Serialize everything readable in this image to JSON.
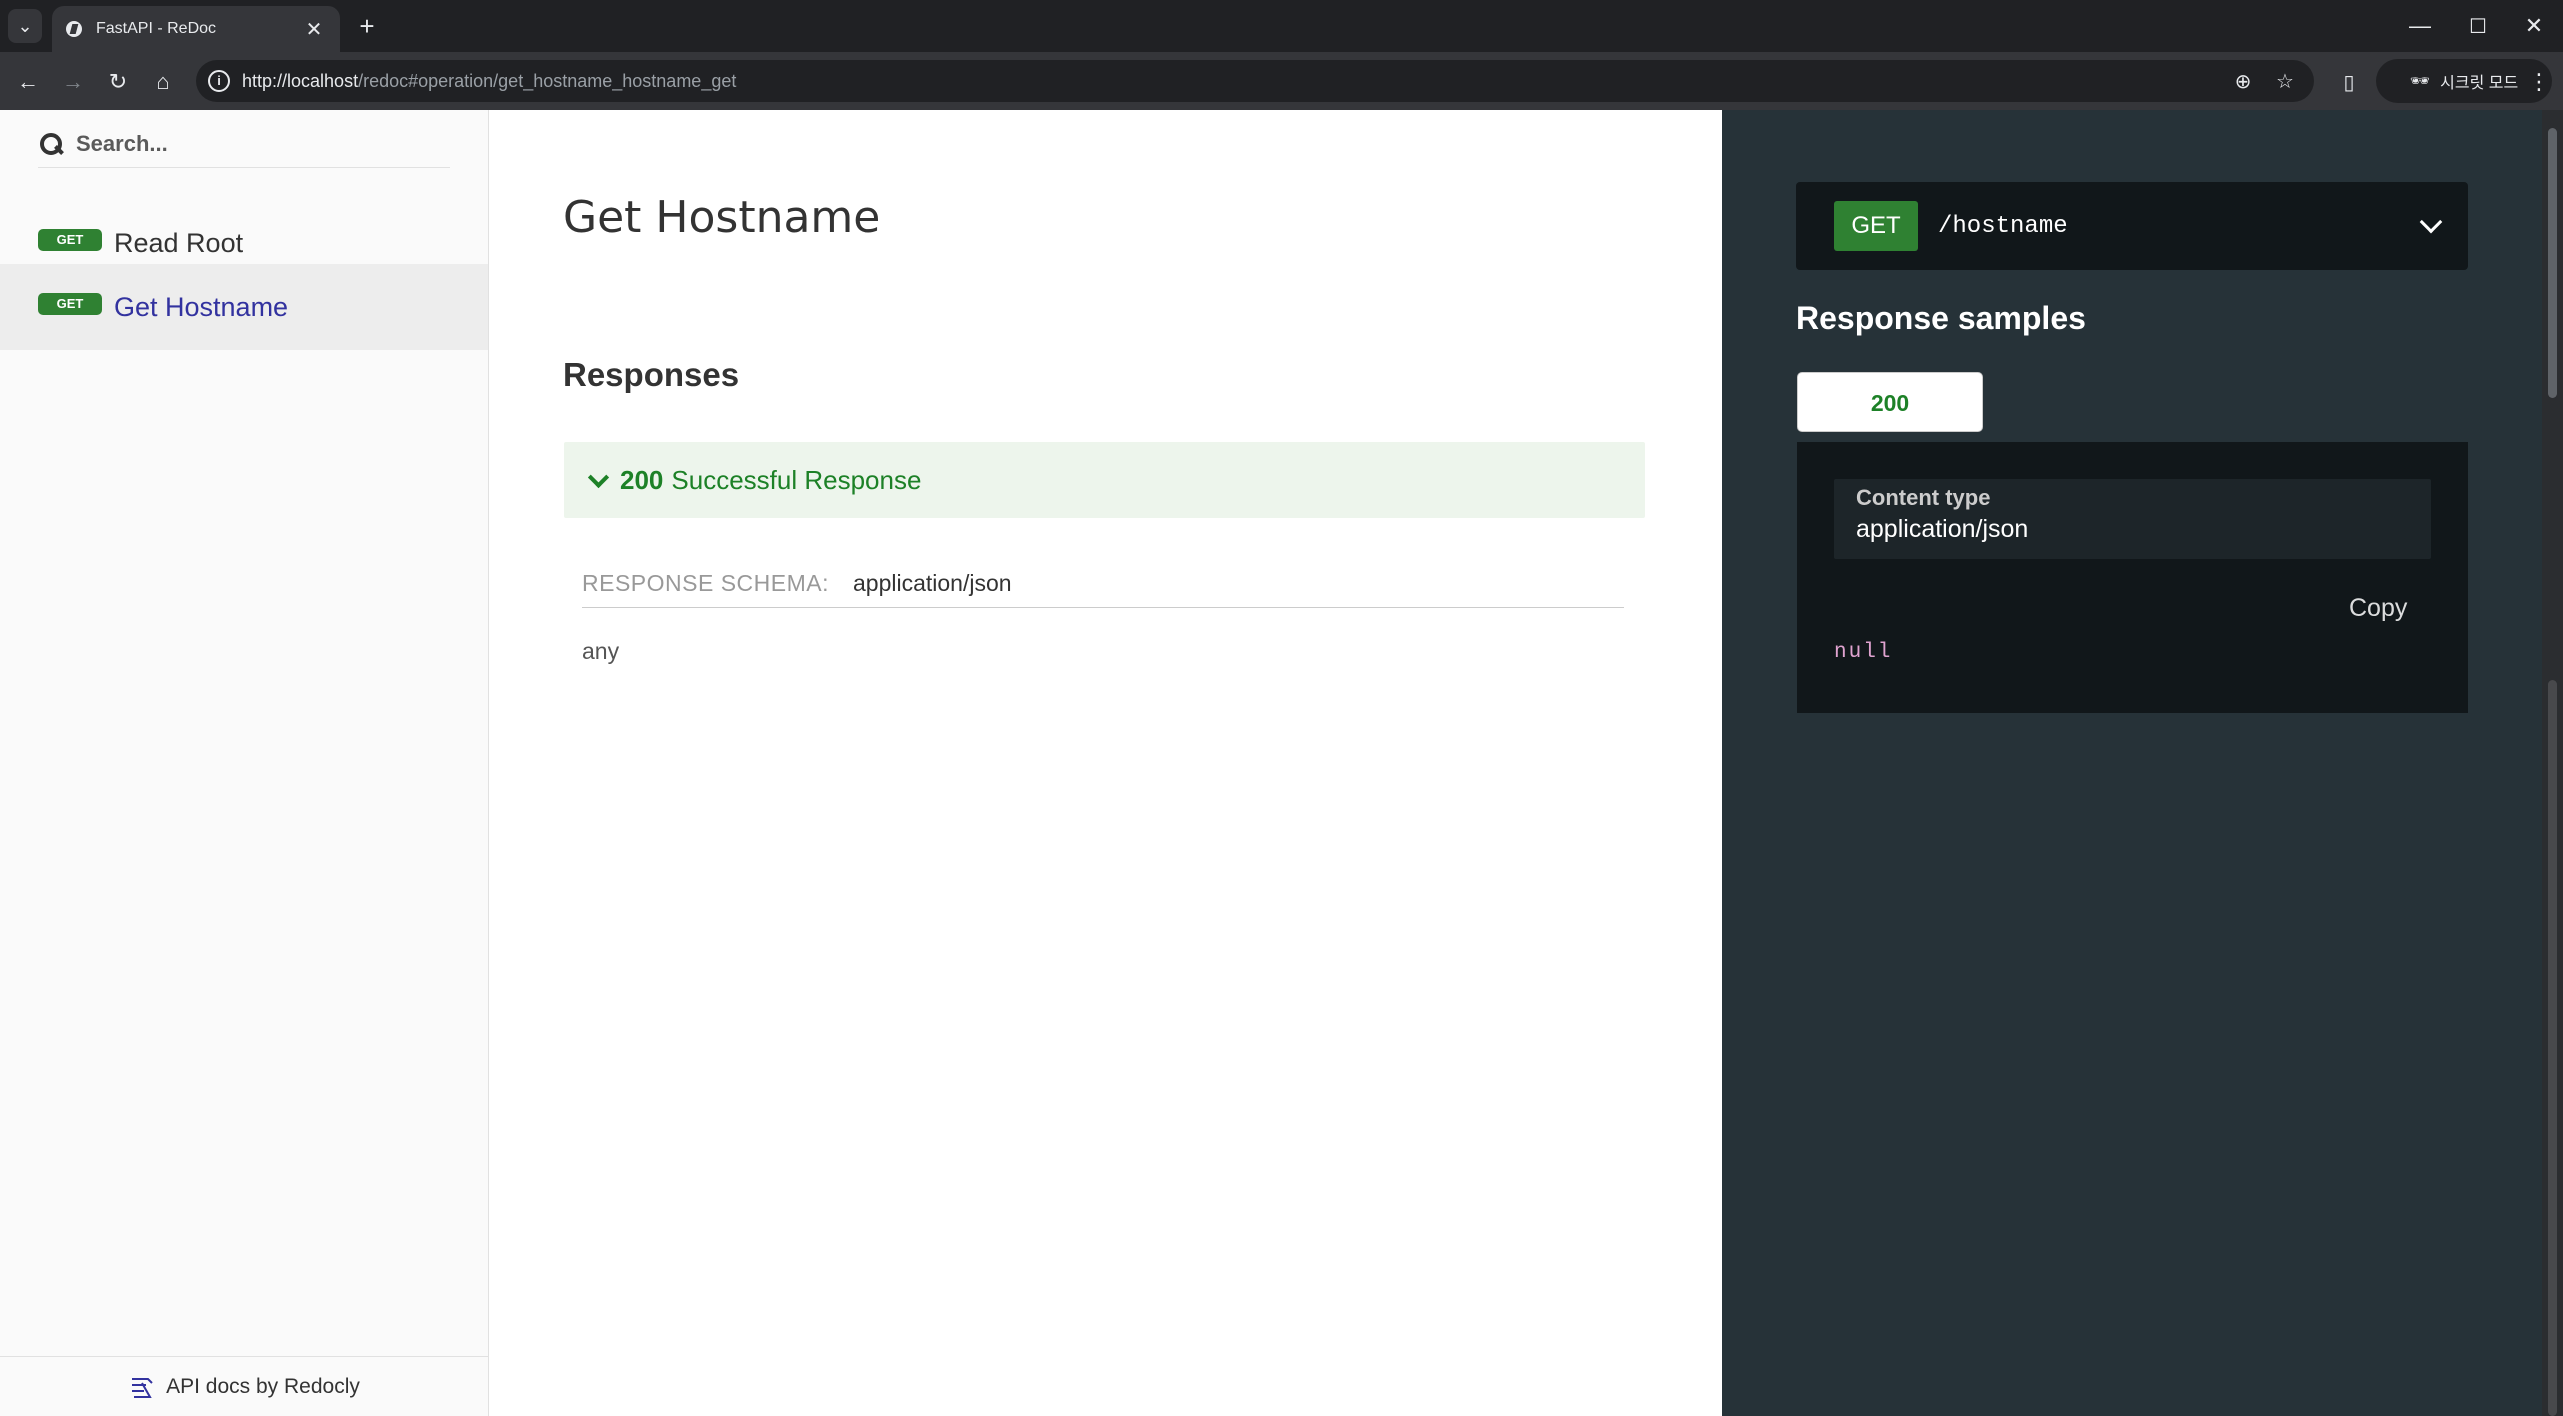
{
  "browser": {
    "tab_title": "FastAPI - ReDoc",
    "tab_close": "✕",
    "new_tab": "+",
    "url_host": "http://localhost",
    "url_path": "/redoc#operation/get_hostname_hostname_get",
    "incognito_label": "시크릿 모드",
    "window_controls": {
      "minimize": "—",
      "maximize": "☐",
      "close": "✕"
    },
    "icons": {
      "back": "←",
      "forward": "→",
      "reload": "↻",
      "home": "⌂",
      "zoom": "⊕",
      "star": "☆",
      "menu": "⋮",
      "tab_list": "⌄",
      "info": "i",
      "side_panel": "▯",
      "incognito": "🕶"
    }
  },
  "sidebar": {
    "search_placeholder": "Search...",
    "items": [
      {
        "method": "GET",
        "label": "Read Root",
        "active": false
      },
      {
        "method": "GET",
        "label": "Get Hostname",
        "active": true
      }
    ],
    "footer": "API docs by Redocly"
  },
  "operation": {
    "title": "Get Hostname",
    "responses_heading": "Responses",
    "response": {
      "code": "200",
      "description": "Successful Response"
    },
    "schema_label": "RESPONSE SCHEMA:",
    "schema_type": "application/json",
    "schema_value": "any"
  },
  "samples": {
    "method": "GET",
    "path": "/hostname",
    "title": "Response samples",
    "status_tab": "200",
    "content_type_label": "Content type",
    "content_type_value": "application/json",
    "copy_label": "Copy",
    "sample_body": "null"
  },
  "colors": {
    "get_badge": "#2f8132",
    "success_green": "#1d8127",
    "right_panel": "#263238",
    "active_nav": "#32329f"
  }
}
